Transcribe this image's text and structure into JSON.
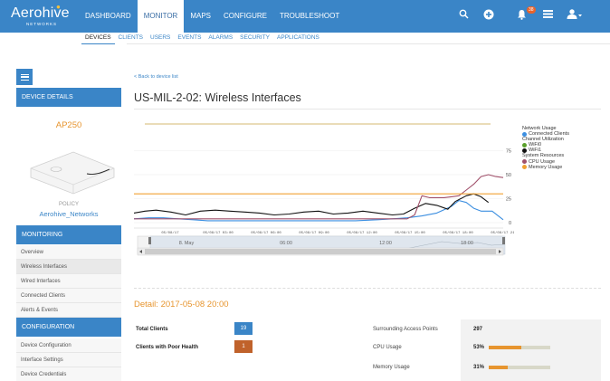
{
  "app": {
    "logo_text": "Aerohive",
    "logo_sub": "NETWORKS",
    "nav": [
      "DASHBOARD",
      "MONITOR",
      "MAPS",
      "CONFIGURE",
      "TROUBLESHOOT"
    ],
    "active_nav": "MONITOR",
    "notification_count": "38",
    "icons": [
      "search-icon",
      "add-circle-icon",
      "bell-icon",
      "list-icon",
      "user-icon"
    ]
  },
  "subnav": {
    "items": [
      "DEVICES",
      "CLIENTS",
      "USERS",
      "EVENTS",
      "ALARMS",
      "SECURITY",
      "APPLICATIONS"
    ],
    "active": "DEVICES"
  },
  "sidebar": {
    "device_details_label": "DEVICE DETAILS",
    "model": "AP250",
    "policy_label": "POLICY",
    "policy_value": "Aerohive_Networks",
    "monitoring_label": "MONITORING",
    "monitoring_items": [
      "Overview",
      "Wireless Interfaces",
      "Wired Interfaces",
      "Connected Clients",
      "Alerts & Events"
    ],
    "configuration_label": "CONFIGURATION",
    "configuration_items": [
      "Device Configuration",
      "Interface Settings",
      "Device Credentials"
    ]
  },
  "main": {
    "back_link": "< Back to device list",
    "title": "US-MIL-2-02: Wireless Interfaces",
    "detail_title": "Detail: 2017-05-08 20:00"
  },
  "chart_data": {
    "type": "line",
    "y_ticks": [
      "75",
      "50",
      "25",
      "0"
    ],
    "ylim": [
      0,
      100
    ],
    "x_ticks": [
      "05/08/17",
      "05/08/17 03:00",
      "05/08/17 06:00",
      "05/08/17 09:00",
      "05/08/17 12:00",
      "05/08/17 15:00",
      "05/08/17 18:00",
      "05/08/17 21:00"
    ],
    "navigator_ticks": [
      "8. May",
      "06:00",
      "12:00",
      "18:00"
    ],
    "legend": {
      "groups": [
        {
          "heading": "Network Usage",
          "entries": [
            {
              "name": "Connected Clients",
              "color": "#3b8ee0"
            }
          ]
        },
        {
          "heading": "Channel Utilization",
          "entries": [
            {
              "name": "WiFi0",
              "color": "#5aa02c"
            },
            {
              "name": "WiFi1",
              "color": "#111111"
            }
          ]
        },
        {
          "heading": "System Resources",
          "entries": [
            {
              "name": "CPU Usage",
              "color": "#a0506a"
            },
            {
              "name": "Memory Usage",
              "color": "#f0a030"
            }
          ]
        }
      ]
    },
    "series": [
      {
        "name": "Connected Clients",
        "color": "#3b8ee0",
        "x": [
          0,
          0.04,
          0.08,
          0.12,
          0.16,
          0.2,
          0.3,
          0.4,
          0.5,
          0.6,
          0.66,
          0.7,
          0.74,
          0.78,
          0.82,
          0.86,
          0.88,
          0.9,
          0.92,
          0.94,
          0.97,
          1.0
        ],
        "y": [
          4,
          5,
          5,
          4,
          3,
          2,
          2,
          2,
          2,
          2,
          3,
          4,
          5,
          7,
          10,
          17,
          23,
          21,
          15,
          12,
          12,
          3
        ]
      },
      {
        "name": "WiFi1",
        "color": "#111111",
        "x": [
          0,
          0.03,
          0.06,
          0.1,
          0.14,
          0.18,
          0.22,
          0.26,
          0.3,
          0.34,
          0.38,
          0.42,
          0.46,
          0.5,
          0.54,
          0.58,
          0.62,
          0.66,
          0.7,
          0.73,
          0.76,
          0.79,
          0.82,
          0.85,
          0.87,
          0.9,
          0.92,
          0.94,
          0.96
        ],
        "y": [
          10,
          12,
          13,
          11,
          8,
          12,
          13,
          12,
          11,
          10,
          8,
          9,
          11,
          12,
          9,
          10,
          12,
          10,
          8,
          9,
          15,
          20,
          18,
          14,
          22,
          28,
          30,
          27,
          21
        ]
      },
      {
        "name": "CPU Usage",
        "color": "#a0506a",
        "x": [
          0,
          0.1,
          0.2,
          0.3,
          0.4,
          0.5,
          0.6,
          0.65,
          0.7,
          0.74,
          0.76,
          0.78,
          0.8,
          0.84,
          0.86,
          0.88,
          0.9,
          0.92,
          0.94,
          0.96,
          0.98,
          1.0
        ],
        "y": [
          4,
          4,
          4,
          4,
          4,
          4,
          4,
          4,
          4,
          4,
          8,
          28,
          26,
          26,
          27,
          28,
          34,
          40,
          48,
          50,
          48,
          47
        ]
      },
      {
        "name": "Memory Usage",
        "color": "#f0a030",
        "x": [
          0,
          0.2,
          0.4,
          0.6,
          0.8,
          1.0
        ],
        "y": [
          30,
          30,
          30,
          30,
          30,
          30
        ]
      }
    ],
    "top_line": {
      "color": "#c9a040"
    }
  },
  "stats": {
    "total_clients_label": "Total Clients",
    "total_clients_value": "19",
    "poor_health_label": "Clients with Poor Health",
    "poor_health_value": "1",
    "surrounding_ap_label": "Surrounding Access Points",
    "surrounding_ap_value": "297",
    "cpu_label": "CPU Usage",
    "cpu_value": "53%",
    "cpu_fraction": 0.53,
    "memory_label": "Memory Usage",
    "memory_value": "31%",
    "memory_fraction": 0.31,
    "colors": {
      "total_badge": "#3a85c7",
      "poor_badge": "#c0622b"
    }
  }
}
